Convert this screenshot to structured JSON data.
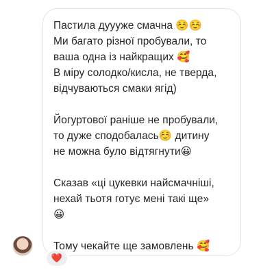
{
  "message": {
    "paragraphs": [
      {
        "lines": [
          "Пастила дуууже смачна ☺️☺️",
          "Ми багато різної пробували, то",
          "ваша одна із найкращих 🥰",
          "В міру солодко/кисла, не тверда,",
          "відчуваються смаки ягід)"
        ]
      },
      {
        "lines": [
          "Йогуртової раніше не пробували,",
          "то дуже сподобалась☺️ дитину",
          "не можна було відтягнути😀"
        ]
      },
      {
        "lines": [
          "Сказав «ці цукевки найсмачніші,",
          "нехай тьотя готує мені такі ще»",
          "😀"
        ]
      },
      {
        "lines": [
          "Тому чекайте ще замовлень 🥰"
        ]
      }
    ]
  },
  "reaction": {
    "emoji": "❤️"
  },
  "colors": {
    "bubble_border": "#e3e3e3",
    "text": "#262626",
    "reaction_bg": "#efefef"
  }
}
